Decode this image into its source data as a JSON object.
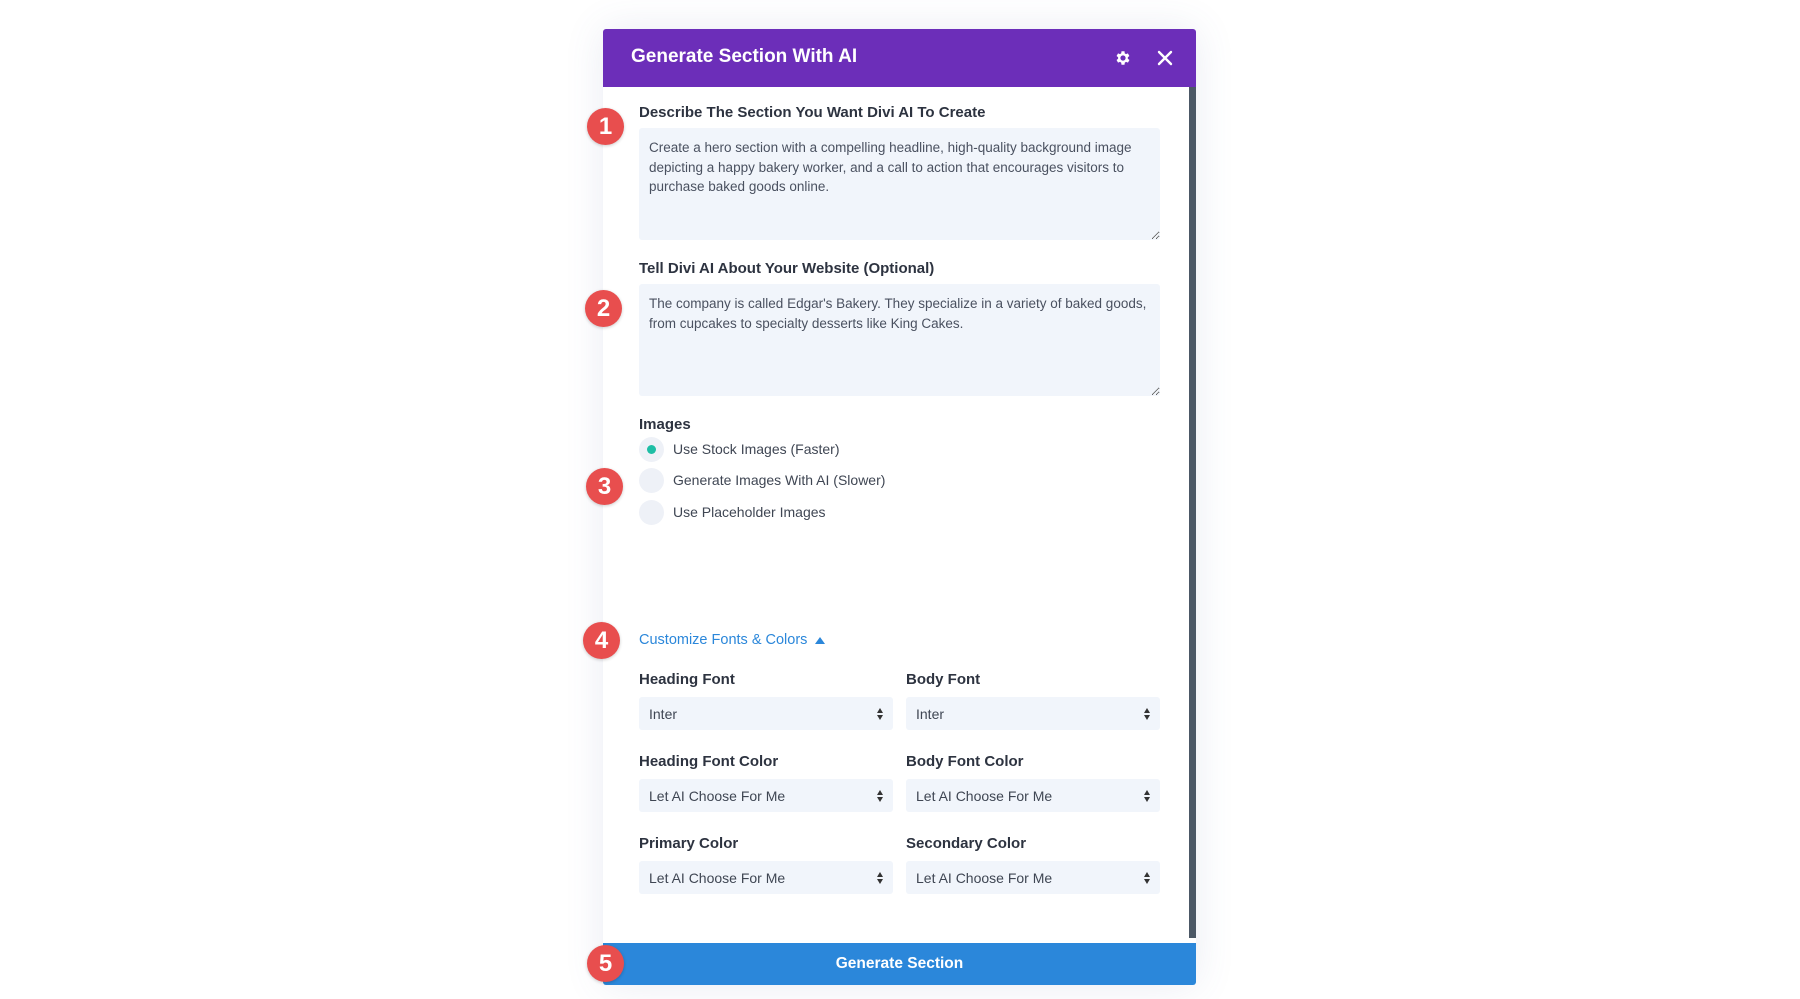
{
  "header": {
    "title": "Generate Section With AI",
    "settings_icon": "gear-icon",
    "close_icon": "close-icon"
  },
  "colors": {
    "header": "#6c2eb9",
    "accent": "#2b87da",
    "badge": "#e84e4e",
    "radio_selected": "#1ebea5"
  },
  "badges": [
    "1",
    "2",
    "3",
    "4",
    "5"
  ],
  "describe": {
    "label": "Describe The Section You Want Divi AI To Create",
    "value": "Create a hero section with a compelling headline, high-quality background image depicting a happy bakery worker, and a call to action that encourages visitors to purchase baked goods online."
  },
  "website": {
    "label": "Tell Divi AI About Your Website (Optional)",
    "value": "The company is called Edgar's Bakery. They specialize in a variety of baked goods, from cupcakes to specialty desserts like King Cakes."
  },
  "images": {
    "label": "Images",
    "options": [
      {
        "label": "Use Stock Images (Faster)",
        "selected": true
      },
      {
        "label": "Generate Images With AI (Slower)",
        "selected": false
      },
      {
        "label": "Use Placeholder Images",
        "selected": false
      }
    ]
  },
  "customize": {
    "label": "Customize Fonts & Colors",
    "expanded": true,
    "fields": [
      {
        "label": "Heading Font",
        "value": "Inter"
      },
      {
        "label": "Body Font",
        "value": "Inter"
      },
      {
        "label": "Heading Font Color",
        "value": "Let AI Choose For Me"
      },
      {
        "label": "Body Font Color",
        "value": "Let AI Choose For Me"
      },
      {
        "label": "Primary Color",
        "value": "Let AI Choose For Me"
      },
      {
        "label": "Secondary Color",
        "value": "Let AI Choose For Me"
      }
    ]
  },
  "generate_button": "Generate Section"
}
